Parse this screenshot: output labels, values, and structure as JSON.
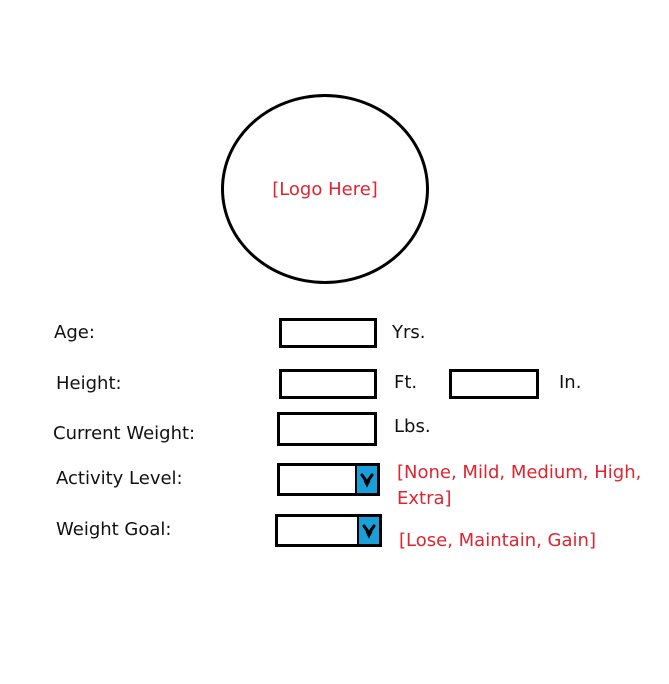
{
  "logo": {
    "placeholder": "[Logo Here]"
  },
  "form": {
    "age": {
      "label": "Age:",
      "unit": "Yrs."
    },
    "height": {
      "label": "Height:",
      "unit_ft": "Ft.",
      "unit_in": "In."
    },
    "current_weight": {
      "label": "Current Weight:",
      "unit": "Lbs."
    },
    "activity_level": {
      "label": "Activity Level:",
      "options_note": "[None, Mild, Medium, High, Extra]"
    },
    "weight_goal": {
      "label": "Weight Goal:",
      "options_note": "[Lose, Maintain, Gain]"
    }
  },
  "colors": {
    "annotation": "#e0242f",
    "dropdown_arrow_bg": "#1b9fd9",
    "border": "#000000"
  },
  "icons": {
    "dropdown": "chevron-down-icon"
  }
}
